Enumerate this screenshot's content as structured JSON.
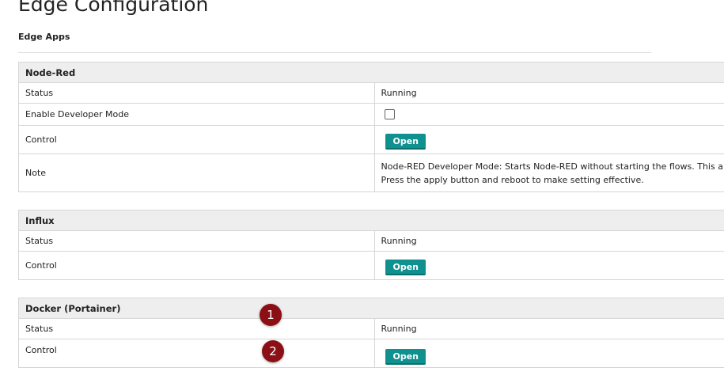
{
  "page": {
    "title": "Edge Configuration",
    "subtitle": "Edge Apps"
  },
  "sections": [
    {
      "header": "Node-Red",
      "status_label": "Status",
      "status_value": "Running",
      "dev_label": "Enable Developer Mode",
      "dev_checked": false,
      "control_label": "Control",
      "open_label": "Open",
      "note_label": "Note",
      "note_line1": "Node-RED Developer Mode: Starts Node-RED without starting the flows. This allows you to open the flows in the edi",
      "note_line2": "Press the apply button and reboot to make setting effective."
    },
    {
      "header": "Influx",
      "status_label": "Status",
      "status_value": "Running",
      "control_label": "Control",
      "open_label": "Open"
    },
    {
      "header": "Docker (Portainer)",
      "status_label": "Status",
      "status_value": "Running",
      "control_label": "Control",
      "open_label": "Open"
    }
  ],
  "markers": [
    "1",
    "2"
  ],
  "colors": {
    "button": "#0e918f",
    "marker": "#8b1016",
    "header_bg": "#eeeeee"
  }
}
